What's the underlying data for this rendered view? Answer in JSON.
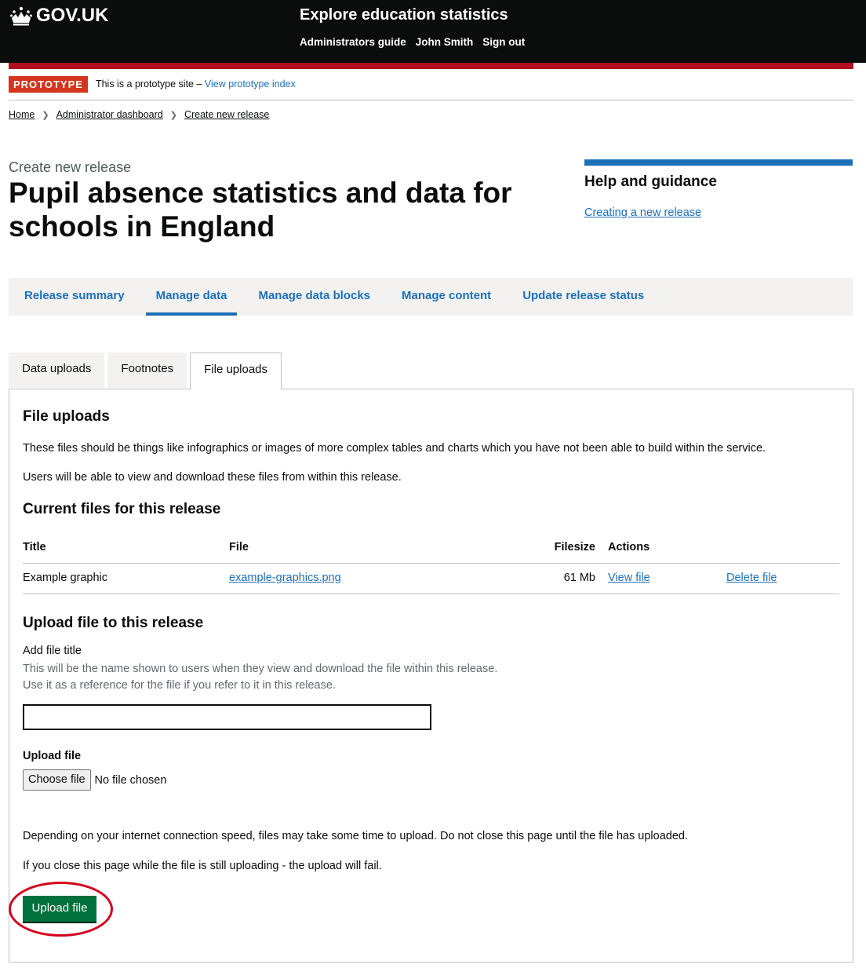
{
  "header": {
    "logo_text": "GOV.UK",
    "service_name": "Explore education statistics",
    "nav": [
      "Administrators guide",
      "John Smith",
      "Sign out"
    ]
  },
  "phase_banner": {
    "tag": "PROTOTYPE",
    "text": "This is a prototype site – ",
    "link": "View prototype index"
  },
  "breadcrumbs": [
    "Home",
    "Administrator dashboard",
    "Create new release"
  ],
  "page": {
    "caption": "Create new release",
    "title": "Pupil absence statistics and data for schools in England"
  },
  "help": {
    "heading": "Help and guidance",
    "link": "Creating a new release"
  },
  "primary_nav": {
    "items": [
      "Release summary",
      "Manage data",
      "Manage data blocks",
      "Manage content",
      "Update release status"
    ],
    "active": "Manage data"
  },
  "tabs": {
    "items": [
      "Data uploads",
      "Footnotes",
      "File uploads"
    ],
    "active": "File uploads"
  },
  "file_uploads": {
    "heading": "File uploads",
    "intro_1": "These files should be things like infographics or images of more complex tables and charts which you have not been able to build within the service.",
    "intro_2": "Users will be able to view and download these files from within this release.",
    "current_heading": "Current files for this release",
    "table": {
      "headers": [
        "Title",
        "File",
        "Filesize",
        "Actions"
      ],
      "rows": [
        {
          "title": "Example graphic",
          "file": "example-graphics.png",
          "filesize": "61 Mb",
          "view": "View file",
          "delete": "Delete file"
        }
      ]
    },
    "upload_heading": "Upload file to this release",
    "title_label": "Add file title",
    "title_hint_1": "This will be the name shown to users when they view and download the file within this release.",
    "title_hint_2": "Use it as a reference for the file if you refer to it in this release.",
    "title_value": "",
    "file_label": "Upload file",
    "choose_button": "Choose file",
    "no_file": "No file chosen",
    "note_1": "Depending on your internet connection speed, files may take some time to upload. Do not close this page until the file has uploaded.",
    "note_2": "If you close this page while the file is still uploading - the upload will fail.",
    "submit": "Upload file"
  },
  "colors": {
    "header_bg": "#0b0c0c",
    "link": "#1d70b8",
    "accent_bar": "#b10e1e",
    "phase_tag": "#d4351c",
    "button": "#00703c",
    "highlight": "#d4001c"
  }
}
